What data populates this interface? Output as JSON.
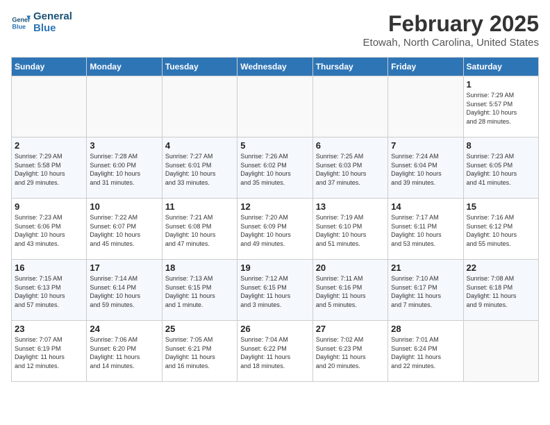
{
  "header": {
    "logo_line1": "General",
    "logo_line2": "Blue",
    "title": "February 2025",
    "subtitle": "Etowah, North Carolina, United States"
  },
  "days_of_week": [
    "Sunday",
    "Monday",
    "Tuesday",
    "Wednesday",
    "Thursday",
    "Friday",
    "Saturday"
  ],
  "weeks": [
    [
      {
        "day": "",
        "info": ""
      },
      {
        "day": "",
        "info": ""
      },
      {
        "day": "",
        "info": ""
      },
      {
        "day": "",
        "info": ""
      },
      {
        "day": "",
        "info": ""
      },
      {
        "day": "",
        "info": ""
      },
      {
        "day": "1",
        "info": "Sunrise: 7:29 AM\nSunset: 5:57 PM\nDaylight: 10 hours\nand 28 minutes."
      }
    ],
    [
      {
        "day": "2",
        "info": "Sunrise: 7:29 AM\nSunset: 5:58 PM\nDaylight: 10 hours\nand 29 minutes."
      },
      {
        "day": "3",
        "info": "Sunrise: 7:28 AM\nSunset: 6:00 PM\nDaylight: 10 hours\nand 31 minutes."
      },
      {
        "day": "4",
        "info": "Sunrise: 7:27 AM\nSunset: 6:01 PM\nDaylight: 10 hours\nand 33 minutes."
      },
      {
        "day": "5",
        "info": "Sunrise: 7:26 AM\nSunset: 6:02 PM\nDaylight: 10 hours\nand 35 minutes."
      },
      {
        "day": "6",
        "info": "Sunrise: 7:25 AM\nSunset: 6:03 PM\nDaylight: 10 hours\nand 37 minutes."
      },
      {
        "day": "7",
        "info": "Sunrise: 7:24 AM\nSunset: 6:04 PM\nDaylight: 10 hours\nand 39 minutes."
      },
      {
        "day": "8",
        "info": "Sunrise: 7:23 AM\nSunset: 6:05 PM\nDaylight: 10 hours\nand 41 minutes."
      }
    ],
    [
      {
        "day": "9",
        "info": "Sunrise: 7:23 AM\nSunset: 6:06 PM\nDaylight: 10 hours\nand 43 minutes."
      },
      {
        "day": "10",
        "info": "Sunrise: 7:22 AM\nSunset: 6:07 PM\nDaylight: 10 hours\nand 45 minutes."
      },
      {
        "day": "11",
        "info": "Sunrise: 7:21 AM\nSunset: 6:08 PM\nDaylight: 10 hours\nand 47 minutes."
      },
      {
        "day": "12",
        "info": "Sunrise: 7:20 AM\nSunset: 6:09 PM\nDaylight: 10 hours\nand 49 minutes."
      },
      {
        "day": "13",
        "info": "Sunrise: 7:19 AM\nSunset: 6:10 PM\nDaylight: 10 hours\nand 51 minutes."
      },
      {
        "day": "14",
        "info": "Sunrise: 7:17 AM\nSunset: 6:11 PM\nDaylight: 10 hours\nand 53 minutes."
      },
      {
        "day": "15",
        "info": "Sunrise: 7:16 AM\nSunset: 6:12 PM\nDaylight: 10 hours\nand 55 minutes."
      }
    ],
    [
      {
        "day": "16",
        "info": "Sunrise: 7:15 AM\nSunset: 6:13 PM\nDaylight: 10 hours\nand 57 minutes."
      },
      {
        "day": "17",
        "info": "Sunrise: 7:14 AM\nSunset: 6:14 PM\nDaylight: 10 hours\nand 59 minutes."
      },
      {
        "day": "18",
        "info": "Sunrise: 7:13 AM\nSunset: 6:15 PM\nDaylight: 11 hours\nand 1 minute."
      },
      {
        "day": "19",
        "info": "Sunrise: 7:12 AM\nSunset: 6:15 PM\nDaylight: 11 hours\nand 3 minutes."
      },
      {
        "day": "20",
        "info": "Sunrise: 7:11 AM\nSunset: 6:16 PM\nDaylight: 11 hours\nand 5 minutes."
      },
      {
        "day": "21",
        "info": "Sunrise: 7:10 AM\nSunset: 6:17 PM\nDaylight: 11 hours\nand 7 minutes."
      },
      {
        "day": "22",
        "info": "Sunrise: 7:08 AM\nSunset: 6:18 PM\nDaylight: 11 hours\nand 9 minutes."
      }
    ],
    [
      {
        "day": "23",
        "info": "Sunrise: 7:07 AM\nSunset: 6:19 PM\nDaylight: 11 hours\nand 12 minutes."
      },
      {
        "day": "24",
        "info": "Sunrise: 7:06 AM\nSunset: 6:20 PM\nDaylight: 11 hours\nand 14 minutes."
      },
      {
        "day": "25",
        "info": "Sunrise: 7:05 AM\nSunset: 6:21 PM\nDaylight: 11 hours\nand 16 minutes."
      },
      {
        "day": "26",
        "info": "Sunrise: 7:04 AM\nSunset: 6:22 PM\nDaylight: 11 hours\nand 18 minutes."
      },
      {
        "day": "27",
        "info": "Sunrise: 7:02 AM\nSunset: 6:23 PM\nDaylight: 11 hours\nand 20 minutes."
      },
      {
        "day": "28",
        "info": "Sunrise: 7:01 AM\nSunset: 6:24 PM\nDaylight: 11 hours\nand 22 minutes."
      },
      {
        "day": "",
        "info": ""
      }
    ]
  ]
}
